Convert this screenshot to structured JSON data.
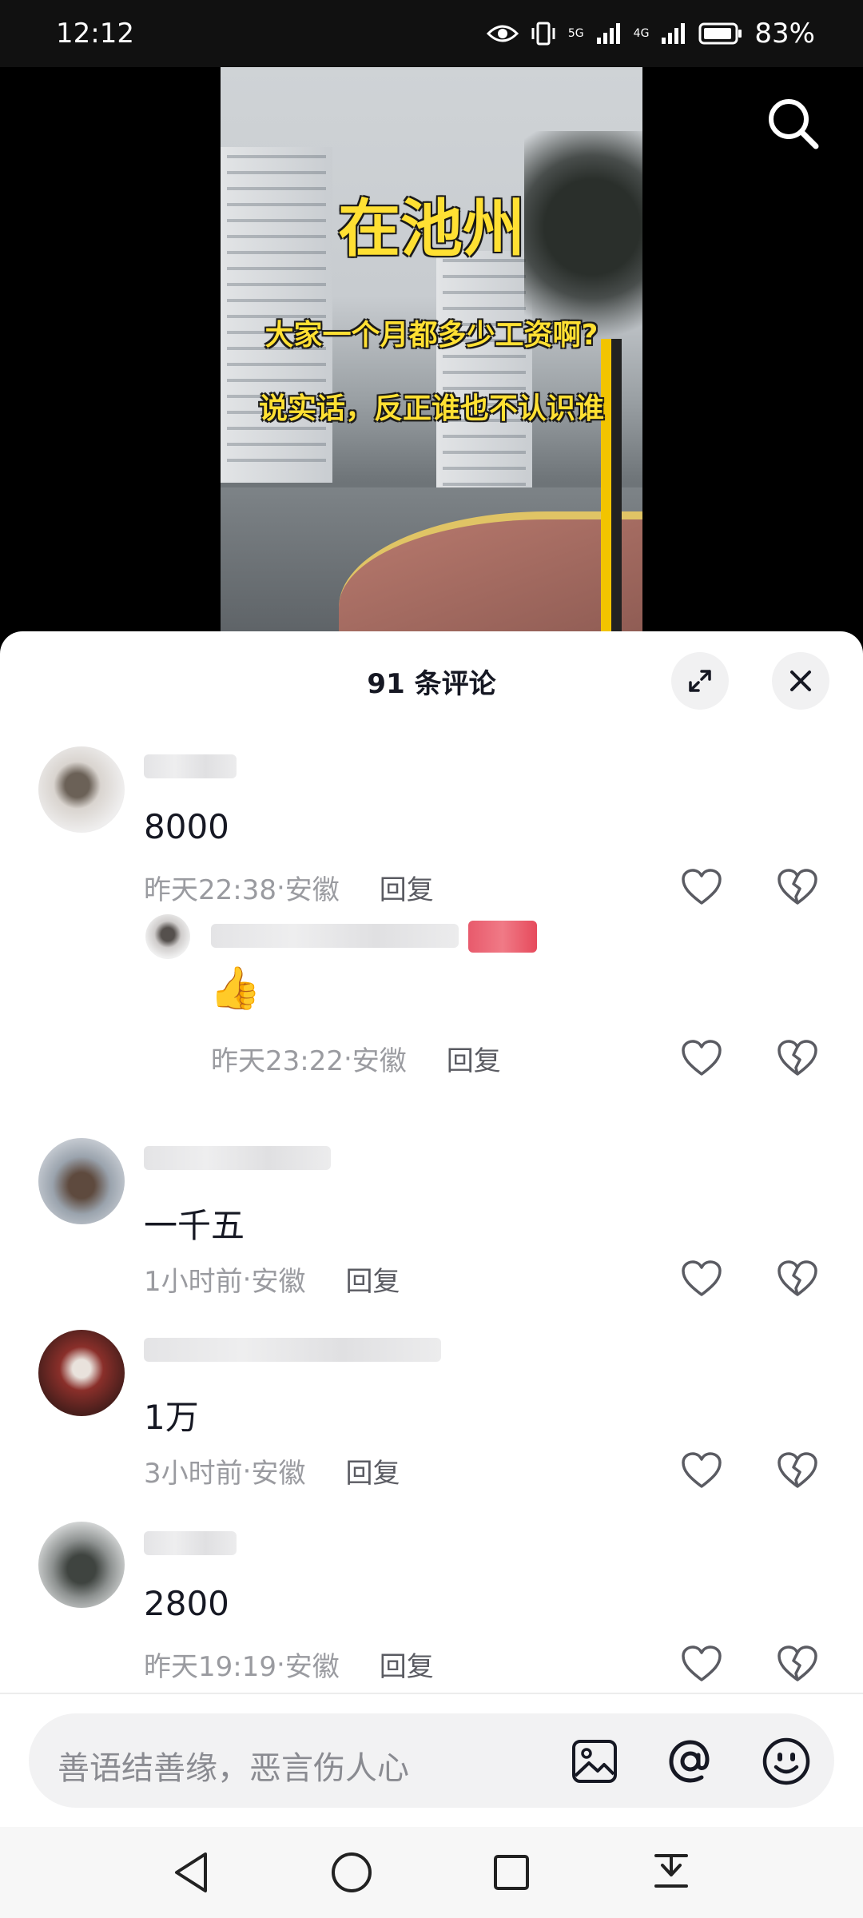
{
  "status_bar": {
    "time": "12:12",
    "network1": "5G",
    "network2": "4G",
    "battery": "83%"
  },
  "video": {
    "title": "在池州",
    "line1": "大家一个月都多少工资啊?",
    "line2": "说实话，反正谁也不认识谁"
  },
  "comments_header": {
    "title": "91 条评论"
  },
  "comments": [
    {
      "text": "8000",
      "time": "昨天22:38",
      "location": "安徽",
      "reply_label": "回复"
    },
    {
      "text": "👍",
      "time": "昨天23:22",
      "location": "安徽",
      "reply_label": "回复"
    },
    {
      "text": "一千五",
      "time": "1小时前",
      "location": "安徽",
      "reply_label": "回复"
    },
    {
      "text": "1万",
      "time": "3小时前",
      "location": "安徽",
      "reply_label": "回复"
    },
    {
      "text": "2800",
      "time": "昨天19:19",
      "location": "安徽",
      "reply_label": "回复"
    }
  ],
  "meta_separator": " · ",
  "input": {
    "placeholder": "善语结善缘，恶言伤人心"
  },
  "icons": {
    "search": "search-icon",
    "expand": "expand-icon",
    "close": "close-icon",
    "like": "heart-icon",
    "dislike": "broken-heart-icon",
    "image": "image-icon",
    "mention": "at-icon",
    "emoji": "emoji-icon"
  }
}
